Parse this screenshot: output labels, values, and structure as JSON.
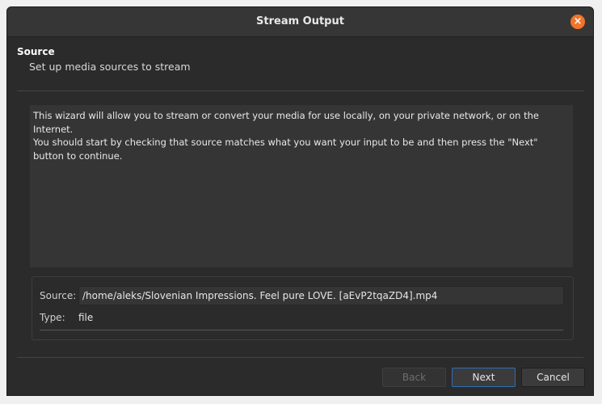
{
  "window": {
    "title": "Stream Output",
    "close_icon_glyph": "×"
  },
  "header": {
    "title": "Source",
    "subtitle": "Set up media sources to stream"
  },
  "description": {
    "line1": "This wizard will allow you to stream or convert your media for use locally, on your private network, or on the Internet.",
    "line2": "You should start by checking that source matches what you want your input to be and then press the \"Next\" button to continue."
  },
  "source": {
    "label": "Source:",
    "value": "/home/aleks/Slovenian Impressions. Feel pure LOVE. [aEvP2tqaZD4].mp4",
    "type_label": "Type:",
    "type_value": "file"
  },
  "buttons": {
    "back": "Back",
    "next": "Next",
    "cancel": "Cancel"
  },
  "colors": {
    "window_bg": "#2b2b2b",
    "close_button": "#f37329",
    "focus_border": "#2e6fb5"
  }
}
